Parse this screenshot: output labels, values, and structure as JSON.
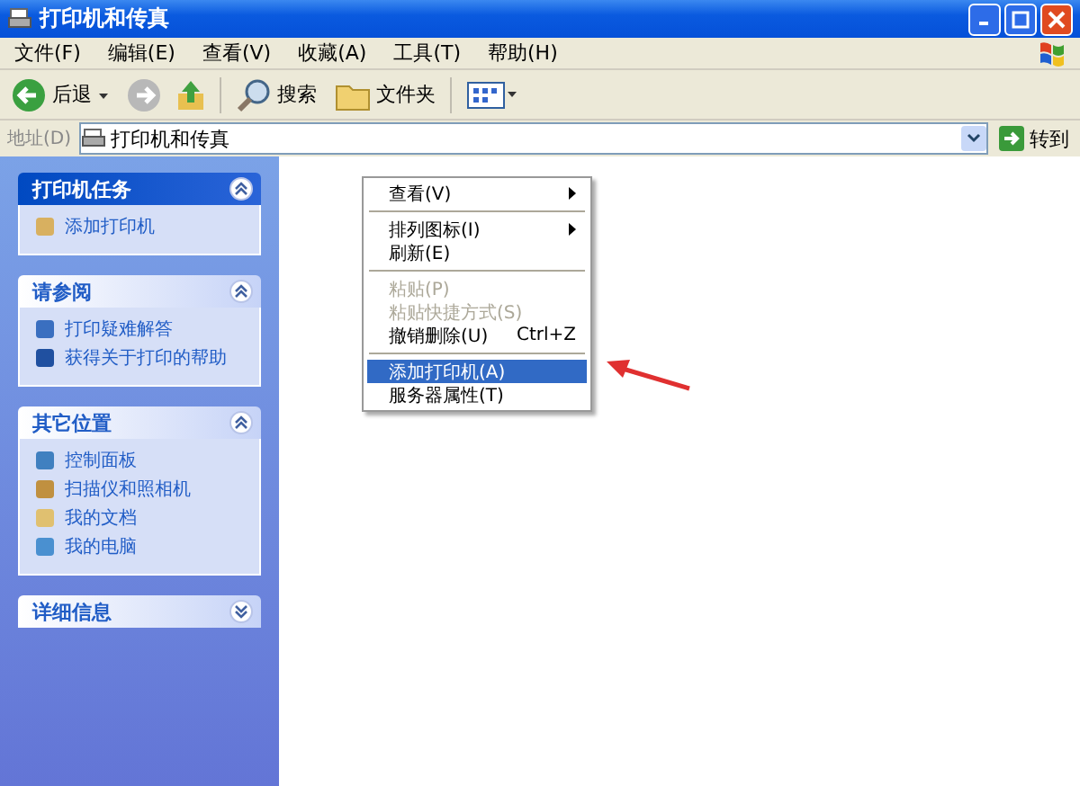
{
  "window": {
    "title": "打印机和传真"
  },
  "menubar": [
    "文件(F)",
    "编辑(E)",
    "查看(V)",
    "收藏(A)",
    "工具(T)",
    "帮助(H)"
  ],
  "toolbar": {
    "back": "后退",
    "search": "搜索",
    "folders": "文件夹"
  },
  "address": {
    "label": "地址(D)",
    "value": "打印机和传真",
    "go": "转到"
  },
  "sidebar": [
    {
      "title": "打印机任务",
      "expanded": true,
      "items": [
        "添加打印机"
      ]
    },
    {
      "title": "请参阅",
      "expanded": true,
      "items": [
        "打印疑难解答",
        "获得关于打印的帮助"
      ]
    },
    {
      "title": "其它位置",
      "expanded": true,
      "items": [
        "控制面板",
        "扫描仪和照相机",
        "我的文档",
        "我的电脑"
      ]
    },
    {
      "title": "详细信息",
      "expanded": false
    }
  ],
  "context_menu": [
    {
      "kind": "item",
      "label": "查看(V)",
      "submenu": true,
      "disabled": false,
      "selected": false
    },
    {
      "kind": "separator"
    },
    {
      "kind": "item",
      "label": "排列图标(I)",
      "submenu": true,
      "disabled": false,
      "selected": false
    },
    {
      "kind": "item",
      "label": "刷新(E)",
      "submenu": false,
      "disabled": false,
      "selected": false
    },
    {
      "kind": "separator"
    },
    {
      "kind": "item",
      "label": "粘贴(P)",
      "submenu": false,
      "disabled": true,
      "selected": false
    },
    {
      "kind": "item",
      "label": "粘贴快捷方式(S)",
      "submenu": false,
      "disabled": true,
      "selected": false
    },
    {
      "kind": "item",
      "label": "撤销删除(U)",
      "shortcut": "Ctrl+Z",
      "submenu": false,
      "disabled": false,
      "selected": false
    },
    {
      "kind": "separator"
    },
    {
      "kind": "item",
      "label": "添加打印机(A)",
      "submenu": false,
      "disabled": false,
      "selected": true
    },
    {
      "kind": "item",
      "label": "服务器属性(T)",
      "submenu": false,
      "disabled": false,
      "selected": false
    }
  ]
}
